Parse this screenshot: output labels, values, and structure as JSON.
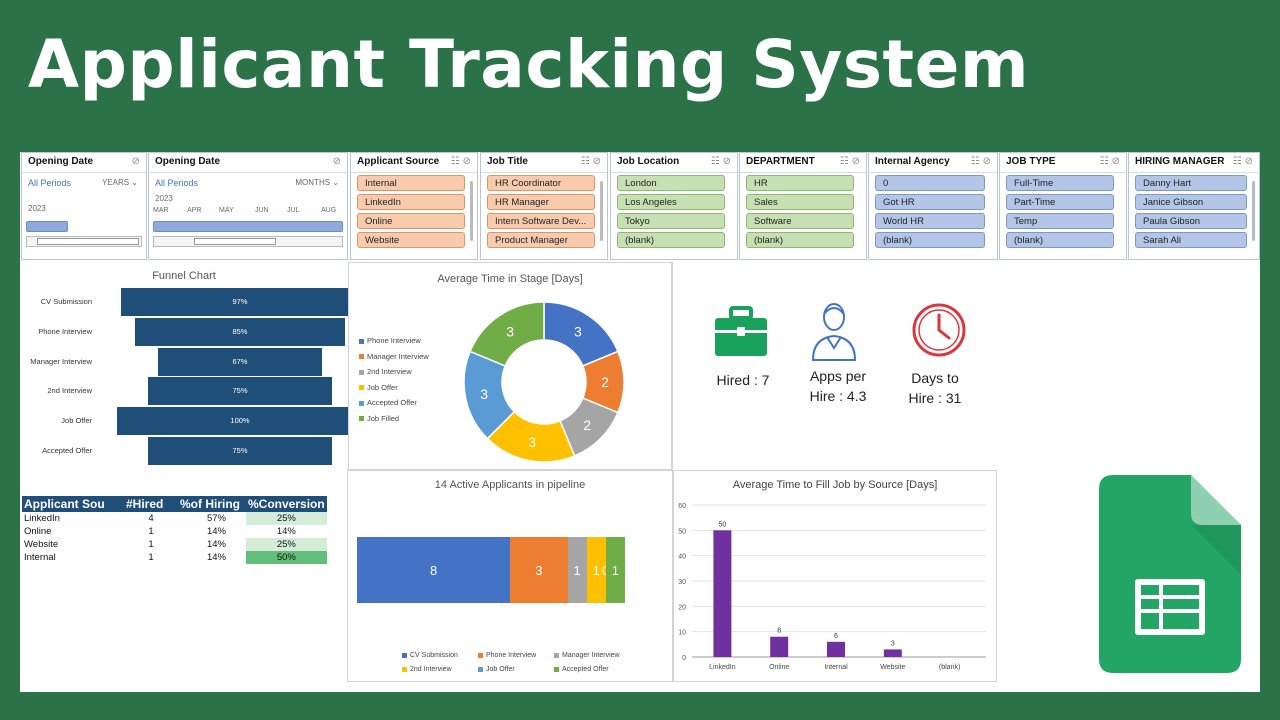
{
  "title": "Applicant Tracking System",
  "timelines": [
    {
      "header": "Opening Date",
      "all_periods": "All Periods",
      "level": "YEARS",
      "year_label": "2023",
      "months": []
    },
    {
      "header": "Opening Date",
      "all_periods": "All Periods",
      "level": "MONTHS",
      "year_label": "2023",
      "months": [
        "MAR",
        "APR",
        "MAY",
        "JUN",
        "JUL",
        "AUG"
      ]
    }
  ],
  "slicers": [
    {
      "header": "Applicant Source",
      "items": [
        "Internal",
        "LinkedIn",
        "Online",
        "Website"
      ]
    },
    {
      "header": "Job Title",
      "items": [
        "HR Coordinator",
        "HR Manager",
        "Intern Software Dev...",
        "Product Manager"
      ]
    },
    {
      "header": "Job Location",
      "items": [
        "London",
        "Los Angeles",
        "Tokyo",
        "(blank)"
      ]
    },
    {
      "header": "DEPARTMENT",
      "items": [
        "HR",
        "Sales",
        "Software",
        "(blank)"
      ]
    },
    {
      "header": "Internal Agency",
      "items": [
        "0",
        "Got HR",
        "World HR",
        "(blank)"
      ]
    },
    {
      "header": "JOB TYPE",
      "items": [
        "Full-Time",
        "Part-Time",
        "Temp",
        "(blank)"
      ]
    },
    {
      "header": "HIRING MANAGER",
      "items": [
        "Danny Hart",
        "Janice Gibson",
        "Paula Gibson",
        "Sarah Ali"
      ]
    }
  ],
  "funnel": {
    "title": "Funnel Chart",
    "rows": [
      {
        "label": "CV Submission",
        "value": 97,
        "text": "97%"
      },
      {
        "label": "Phone Interview",
        "value": 85,
        "text": "85%"
      },
      {
        "label": "Manager Interview",
        "value": 67,
        "text": "67%"
      },
      {
        "label": "2nd Interview",
        "value": 75,
        "text": "75%"
      },
      {
        "label": "Job Offer",
        "value": 100,
        "text": "100%"
      },
      {
        "label": "Accepted Offer",
        "value": 75,
        "text": "75%"
      }
    ]
  },
  "donut": {
    "title": "Average Time in Stage [Days]",
    "slices": [
      {
        "name": "Phone Interview",
        "value": 3,
        "color": "#4472c4"
      },
      {
        "name": "Manager Interview",
        "value": 2,
        "color": "#ed7d31"
      },
      {
        "name": "2nd Interview",
        "value": 2,
        "color": "#a5a5a5"
      },
      {
        "name": "Job Offer",
        "value": 3,
        "color": "#ffc000"
      },
      {
        "name": "Accepted Offer",
        "value": 3,
        "color": "#5b9bd5"
      },
      {
        "name": "Job Filled",
        "value": 3,
        "color": "#70ad47"
      }
    ]
  },
  "kpis": {
    "hired": "Hired : 7",
    "apps_line1": "Apps per",
    "apps_line2": "Hire : 4.3",
    "days_line1": "Days to",
    "days_line2": "Hire : 31",
    "icon_color": "#18a25b",
    "clock_color": "#d9363e",
    "person_color": "#4472c4"
  },
  "source_table": {
    "headers": [
      "Applicant Sou",
      "#Hired",
      "%of Hiring",
      "%Conversion"
    ],
    "rows": [
      {
        "source": "LinkedIn",
        "hired": "4",
        "pct": "57%",
        "conv": "25%",
        "conv_color": "#d5ecd9"
      },
      {
        "source": "Online",
        "hired": "1",
        "pct": "14%",
        "conv": "14%",
        "conv_color": "#ffffff"
      },
      {
        "source": "Website",
        "hired": "1",
        "pct": "14%",
        "conv": "25%",
        "conv_color": "#d5ecd9"
      },
      {
        "source": "Internal",
        "hired": "1",
        "pct": "14%",
        "conv": "50%",
        "conv_color": "#63be7b"
      }
    ]
  },
  "pipeline": {
    "title": "14 Active Applicants in pipeline",
    "segments": [
      {
        "name": "CV Submission",
        "value": 8,
        "label": "8",
        "color": "#4472c4"
      },
      {
        "name": "Phone Interview",
        "value": 3,
        "label": "3",
        "color": "#ed7d31"
      },
      {
        "name": "Manager Interview",
        "value": 1,
        "label": "1",
        "color": "#a5a5a5"
      },
      {
        "name": "2nd Interview",
        "value": 1,
        "label": "1",
        "color": "#ffc000"
      },
      {
        "name": "Job Offer",
        "value": 0,
        "label": "0",
        "color": "#5b9bd5"
      },
      {
        "name": "Accepted Offer",
        "value": 1,
        "label": "1",
        "color": "#70ad47"
      }
    ]
  },
  "chart_data": {
    "type": "bar",
    "title": "Average Time to Fill Job by Source [Days]",
    "categories": [
      "LinkedIn",
      "Online",
      "Internal",
      "Website",
      "(blank)"
    ],
    "values": [
      50,
      8,
      6,
      3,
      null
    ],
    "labels": [
      "50",
      "8",
      "6",
      "3",
      ""
    ],
    "ylim": [
      0,
      60
    ],
    "yticks": [
      0,
      10,
      20,
      30,
      40,
      50,
      60
    ],
    "grid": true,
    "bar_color": "#7030a0"
  }
}
